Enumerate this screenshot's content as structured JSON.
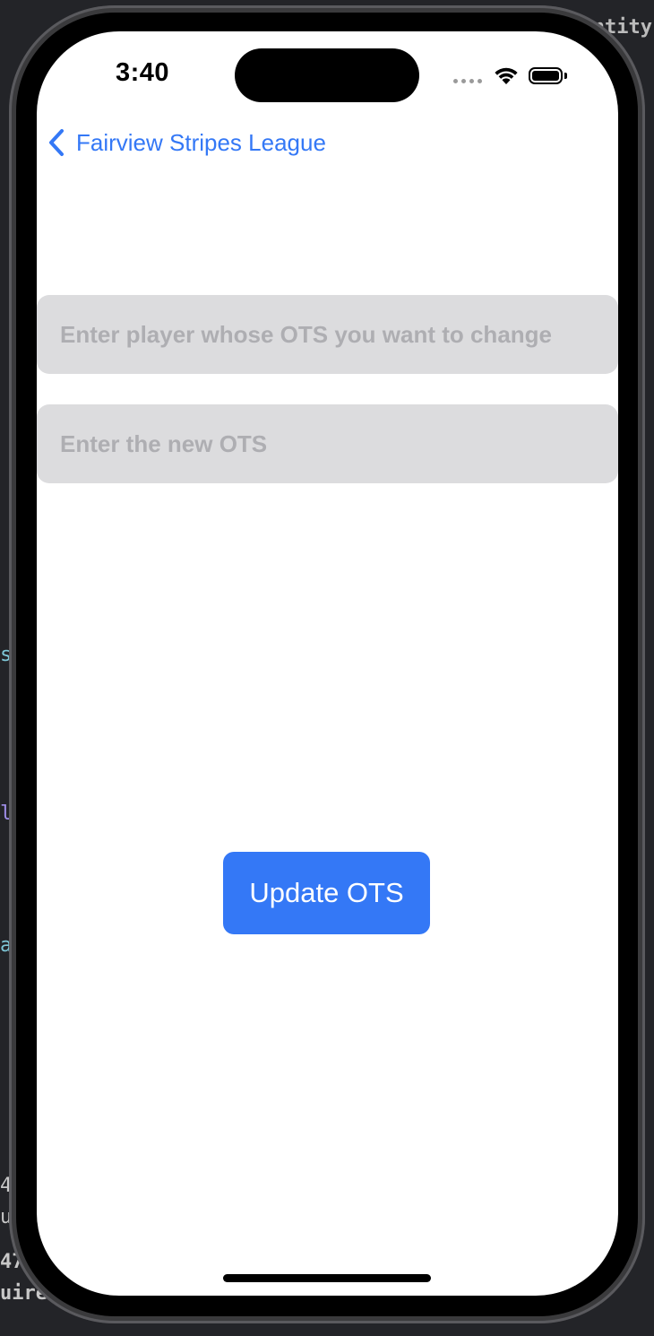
{
  "status_bar": {
    "time": "3:40",
    "icons": [
      "cellular-dots-icon",
      "wifi-icon",
      "battery-icon"
    ]
  },
  "nav": {
    "back_label": "Fairview Stripes League",
    "back_icon": "chevron-left-icon"
  },
  "form": {
    "player_placeholder": "Enter player whose OTS you want to change",
    "player_value": "",
    "new_ots_placeholder": "Enter the new OTS",
    "new_ots_value": ""
  },
  "actions": {
    "update_label": "Update OTS"
  },
  "backdrop": {
    "fragment_top_right": "ntity",
    "fragment_left_1": "4",
    "fragment_left_2": "u",
    "fragment_left_3": "47",
    "fragment_left_4": "uire",
    "fragment_left_5": "s",
    "fragment_left_6": "l",
    "fragment_left_7": "a"
  },
  "colors": {
    "accent": "#3478f6",
    "field_background": "#dcdcde",
    "placeholder": "#aeaeb2"
  }
}
